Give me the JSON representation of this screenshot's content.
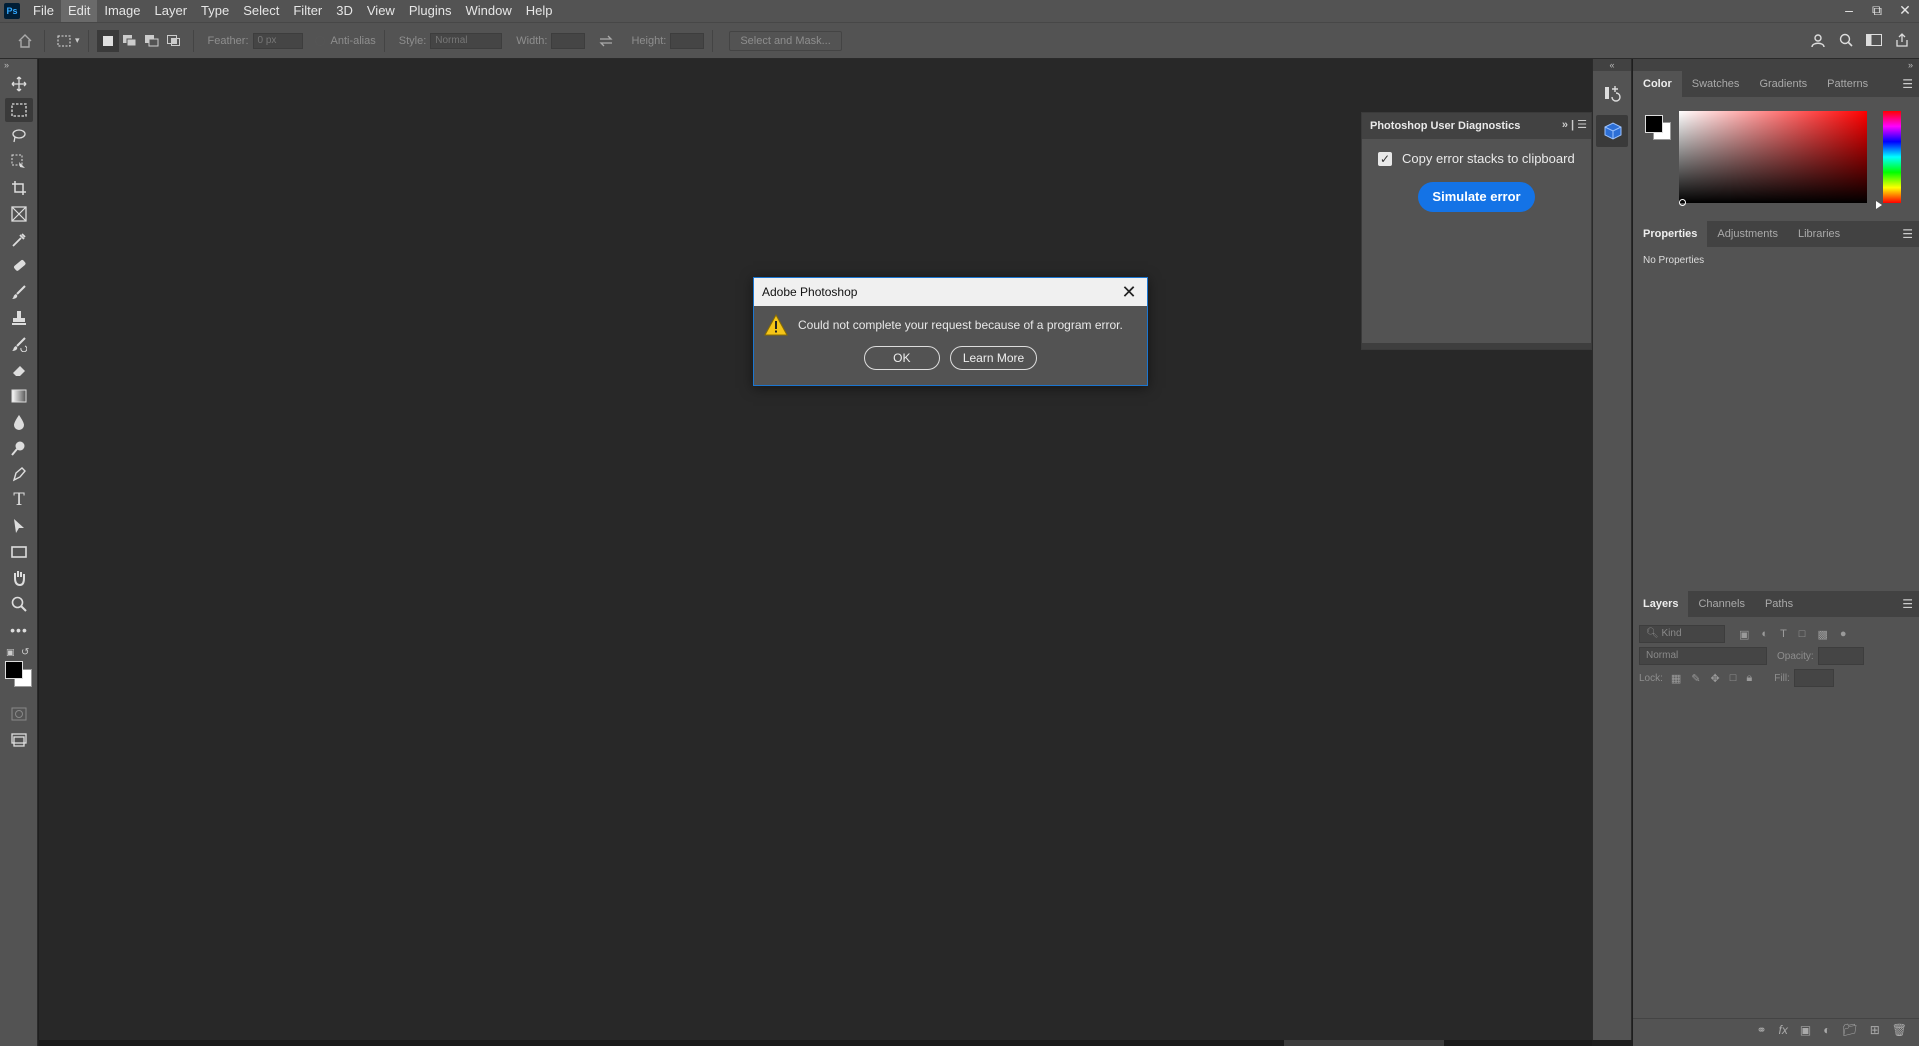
{
  "app": {
    "logo_text": "Ps",
    "menu": [
      "File",
      "Edit",
      "Image",
      "Layer",
      "Type",
      "Select",
      "Filter",
      "3D",
      "View",
      "Plugins",
      "Window",
      "Help"
    ],
    "active_menu": "Edit"
  },
  "options_bar": {
    "feather_label": "Feather:",
    "feather_value": "0 px",
    "anti_alias_label": "Anti-alias",
    "style_label": "Style:",
    "style_value": "Normal",
    "width_label": "Width:",
    "height_label": "Height:",
    "select_mask_label": "Select and Mask..."
  },
  "toolbar": {
    "icons": [
      "move-icon",
      "marquee-icon",
      "lasso-icon",
      "object-select-icon",
      "crop-icon",
      "frame-icon",
      "eyedropper-icon",
      "healing-icon",
      "brush-icon",
      "stamp-icon",
      "history-brush-icon",
      "eraser-icon",
      "gradient-icon",
      "blur-icon",
      "dodge-icon",
      "pen-icon",
      "type-icon",
      "path-select-icon",
      "rectangle-icon",
      "hand-icon",
      "zoom-icon",
      "more-icon"
    ]
  },
  "dialog": {
    "title": "Adobe Photoshop",
    "message": "Could not complete your request because of a program error.",
    "ok_label": "OK",
    "learn_more_label": "Learn More"
  },
  "diagnostics_panel": {
    "title": "Photoshop User Diagnostics",
    "checkbox_label": "Copy error stacks to clipboard",
    "checkbox_checked": true,
    "button_label": "Simulate error"
  },
  "color_panel": {
    "tabs": [
      "Color",
      "Swatches",
      "Gradients",
      "Patterns"
    ],
    "active_tab": "Color",
    "foreground": "#000000",
    "background": "#ffffff",
    "hue_base": "#ff0000"
  },
  "properties_panel": {
    "tabs": [
      "Properties",
      "Adjustments",
      "Libraries"
    ],
    "active_tab": "Properties",
    "empty_text": "No Properties"
  },
  "layers_panel": {
    "tabs": [
      "Layers",
      "Channels",
      "Paths"
    ],
    "active_tab": "Layers",
    "kind_label": "Kind",
    "blend_mode": "Normal",
    "opacity_label": "Opacity:",
    "lock_label": "Lock:",
    "fill_label": "Fill:"
  },
  "colors": {
    "accent": "#1473e6",
    "ui_bg": "#535353",
    "canvas_bg": "#282828"
  }
}
